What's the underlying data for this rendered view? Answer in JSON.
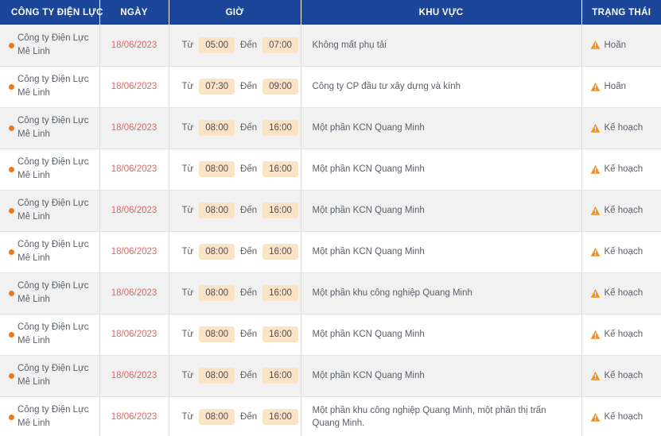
{
  "table": {
    "columns": [
      {
        "key": "company",
        "label": "CÔNG TY ĐIỆN LỰC"
      },
      {
        "key": "date",
        "label": "NGÀY"
      },
      {
        "key": "time",
        "label": "GIỜ"
      },
      {
        "key": "area",
        "label": "KHU VỰC"
      },
      {
        "key": "status",
        "label": "TRẠNG THÁI"
      }
    ],
    "time_labels": {
      "from": "Từ",
      "to": "Đến"
    },
    "colors": {
      "header_bg": "#1b4699",
      "header_text": "#ffffff",
      "row_odd_bg": "#f1f1f1",
      "row_even_bg": "#ffffff",
      "date_text": "#e8615c",
      "chip_bg": "#fae3c6",
      "bullet": "#f07818",
      "warning_icon": "#f5921e",
      "body_text": "#5a6069"
    },
    "rows": [
      {
        "company": "Công ty Điện Lực Mê Linh",
        "bullet": "status-dot-icon",
        "date": "18/06/2023",
        "from": "05:00",
        "to": "07:00",
        "area": "Không mất phụ tải",
        "status": "Hoãn",
        "status_icon": "warning-triangle-icon"
      },
      {
        "company": "Công ty Điện Lực Mê Linh",
        "bullet": "status-dot-icon",
        "date": "18/06/2023",
        "from": "07:30",
        "to": "09:00",
        "area": "Công ty CP đầu tư xây dựng và kính",
        "status": "Hoãn",
        "status_icon": "warning-triangle-icon"
      },
      {
        "company": "Công ty Điện Lực Mê Linh",
        "bullet": "status-dot-icon",
        "date": "18/06/2023",
        "from": "08:00",
        "to": "16:00",
        "area": "Một phần KCN Quang Minh",
        "status": "Kế hoạch",
        "status_icon": "warning-triangle-icon"
      },
      {
        "company": "Công ty Điện Lực Mê Linh",
        "bullet": "status-dot-icon",
        "date": "18/06/2023",
        "from": "08:00",
        "to": "16:00",
        "area": "Một phần KCN Quang Minh",
        "status": "Kế hoạch",
        "status_icon": "warning-triangle-icon"
      },
      {
        "company": "Công ty Điện Lực Mê Linh",
        "bullet": "status-dot-icon",
        "date": "18/06/2023",
        "from": "08:00",
        "to": "16:00",
        "area": "Một phần KCN Quang Minh",
        "status": "Kế hoạch",
        "status_icon": "warning-triangle-icon"
      },
      {
        "company": "Công ty Điện Lực Mê Linh",
        "bullet": "status-dot-icon",
        "date": "18/06/2023",
        "from": "08:00",
        "to": "16:00",
        "area": "Một phần KCN Quang Minh",
        "status": "Kế hoạch",
        "status_icon": "warning-triangle-icon"
      },
      {
        "company": "Công ty Điện Lực Mê Linh",
        "bullet": "status-dot-icon",
        "date": "18/06/2023",
        "from": "08:00",
        "to": "16:00",
        "area": "Một phần khu công nghiệp Quang Minh",
        "status": "Kế hoạch",
        "status_icon": "warning-triangle-icon"
      },
      {
        "company": "Công ty Điện Lực Mê Linh",
        "bullet": "status-dot-icon",
        "date": "18/06/2023",
        "from": "08:00",
        "to": "16:00",
        "area": "Một phần KCN Quang Minh",
        "status": "Kế hoạch",
        "status_icon": "warning-triangle-icon"
      },
      {
        "company": "Công ty Điện Lực Mê Linh",
        "bullet": "status-dot-icon",
        "date": "18/06/2023",
        "from": "08:00",
        "to": "16:00",
        "area": "Một phần KCN Quang Minh",
        "status": "Kế hoạch",
        "status_icon": "warning-triangle-icon"
      },
      {
        "company": "Công ty Điện Lực Mê Linh",
        "bullet": "status-dot-icon",
        "date": "18/06/2023",
        "from": "08:00",
        "to": "16:00",
        "area": "Một phần khu công nghiệp Quang Minh, một phần thị trấn Quang Minh.",
        "status": "Kế hoạch",
        "status_icon": "warning-triangle-icon"
      }
    ]
  }
}
